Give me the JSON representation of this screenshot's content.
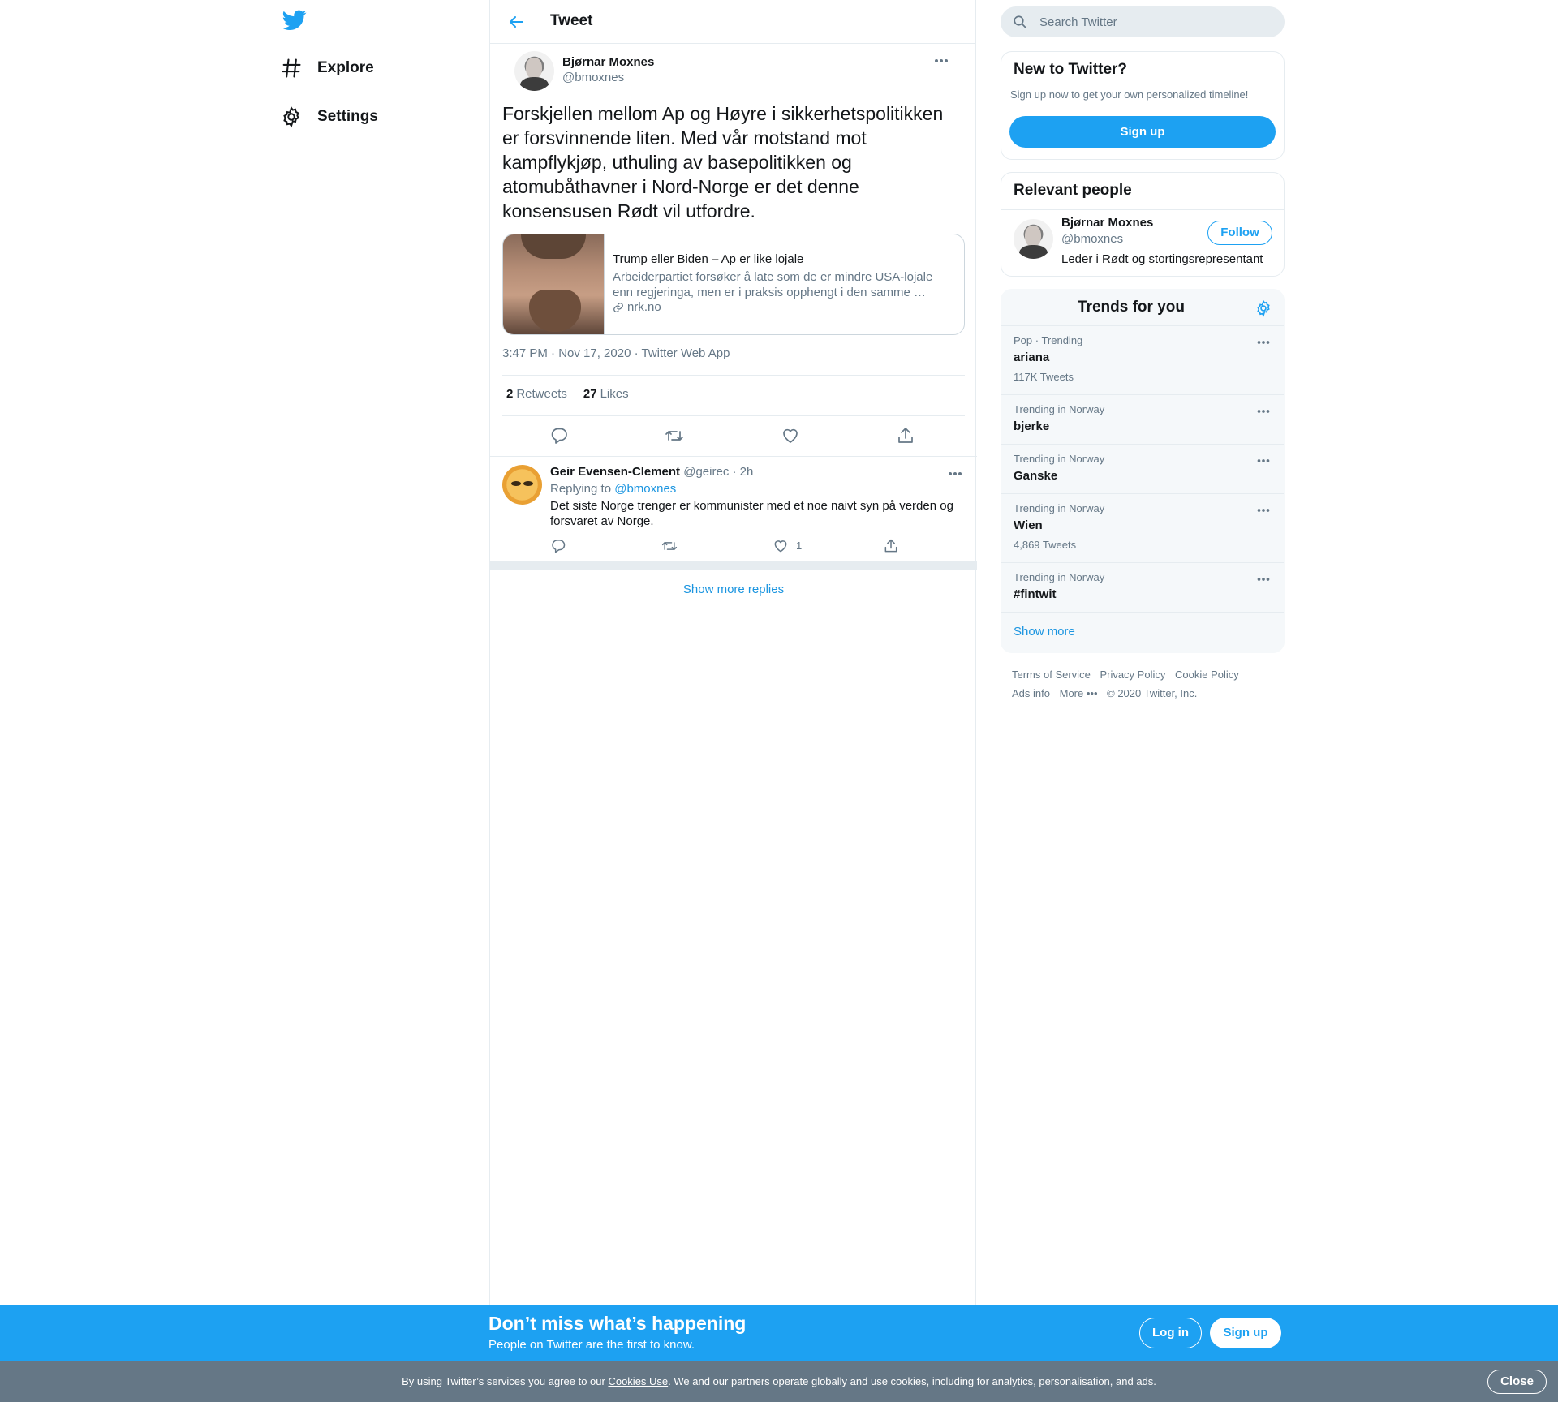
{
  "colors": {
    "accent": "#1da1f2",
    "link": "#1b95e0",
    "muted": "#657786",
    "text": "#14171a",
    "border": "#e6ecf0",
    "cookie_bar": "#657786"
  },
  "nav": {
    "logo_icon": "twitter-bird-icon",
    "items": [
      {
        "label": "Explore",
        "icon": "hashtag-icon"
      },
      {
        "label": "Settings",
        "icon": "gear-icon"
      }
    ]
  },
  "main": {
    "header": {
      "title": "Tweet",
      "back_icon": "arrow-left-icon"
    },
    "tweet": {
      "author_name": "Bjørnar Moxnes",
      "author_handle": "@bmoxnes",
      "text": "Forskjellen mellom Ap og Høyre i sikkerhetspolitikken er forsvinnende liten. Med vår motstand mot kampflykjøp, uthuling av basepolitikken og atomubåthavner i Nord-Norge er det denne konsensusen Rødt vil utfordre.",
      "card": {
        "title": "Trump eller Biden – Ap er like lojale",
        "description": "Arbeiderpartiet forsøker å late som de er mindre USA-lojale enn regjeringa, men er i praksis opphengt i den samme …",
        "domain": "nrk.no"
      },
      "meta": "3:47 PM · Nov 17, 2020 · Twitter Web App",
      "retweets_count": "2",
      "retweets_label": "Retweets",
      "likes_count": "27",
      "likes_label": "Likes"
    },
    "reply": {
      "name": "Geir Evensen-Clement",
      "handle": "@geirec",
      "time": "· 2h",
      "replying_label": "Replying to",
      "replying_handle": "@bmoxnes",
      "text": "Det siste Norge trenger er kommunister med et noe naivt syn på verden og forsvaret av Norge.",
      "like_count": "1"
    },
    "show_more_replies": "Show more replies"
  },
  "sidebar": {
    "search_placeholder": "Search Twitter",
    "new_to_twitter": {
      "title": "New to Twitter?",
      "subtitle": "Sign up now to get your own personalized timeline!",
      "button": "Sign up"
    },
    "relevant_people": {
      "title": "Relevant people",
      "name": "Bjørnar Moxnes",
      "handle": "@bmoxnes",
      "bio": "Leder i Rødt og stortingsrepresentant",
      "follow": "Follow"
    },
    "trends": {
      "title": "Trends for you",
      "items": [
        {
          "context": "Pop · Trending",
          "name": "ariana",
          "count": "117K Tweets"
        },
        {
          "context": "Trending in Norway",
          "name": "bjerke",
          "count": ""
        },
        {
          "context": "Trending in Norway",
          "name": "Ganske",
          "count": ""
        },
        {
          "context": "Trending in Norway",
          "name": "Wien",
          "count": "4,869 Tweets"
        },
        {
          "context": "Trending in Norway",
          "name": "#fintwit",
          "count": ""
        }
      ],
      "show_more": "Show more"
    },
    "footer": {
      "terms": "Terms of Service",
      "privacy": "Privacy Policy",
      "cookie": "Cookie Policy",
      "ads": "Ads info",
      "more": "More •••",
      "copyright": "© 2020 Twitter, Inc."
    }
  },
  "promo": {
    "title": "Don’t miss what’s happening",
    "subtitle": "People on Twitter are the first to know.",
    "login": "Log in",
    "signup": "Sign up"
  },
  "cookie_bar": {
    "text_before": "By using Twitter’s services you agree to our",
    "link": "Cookies Use",
    "text_after": ". We and our partners operate globally and use cookies, including for analytics, personalisation, and ads.",
    "close": "Close"
  }
}
